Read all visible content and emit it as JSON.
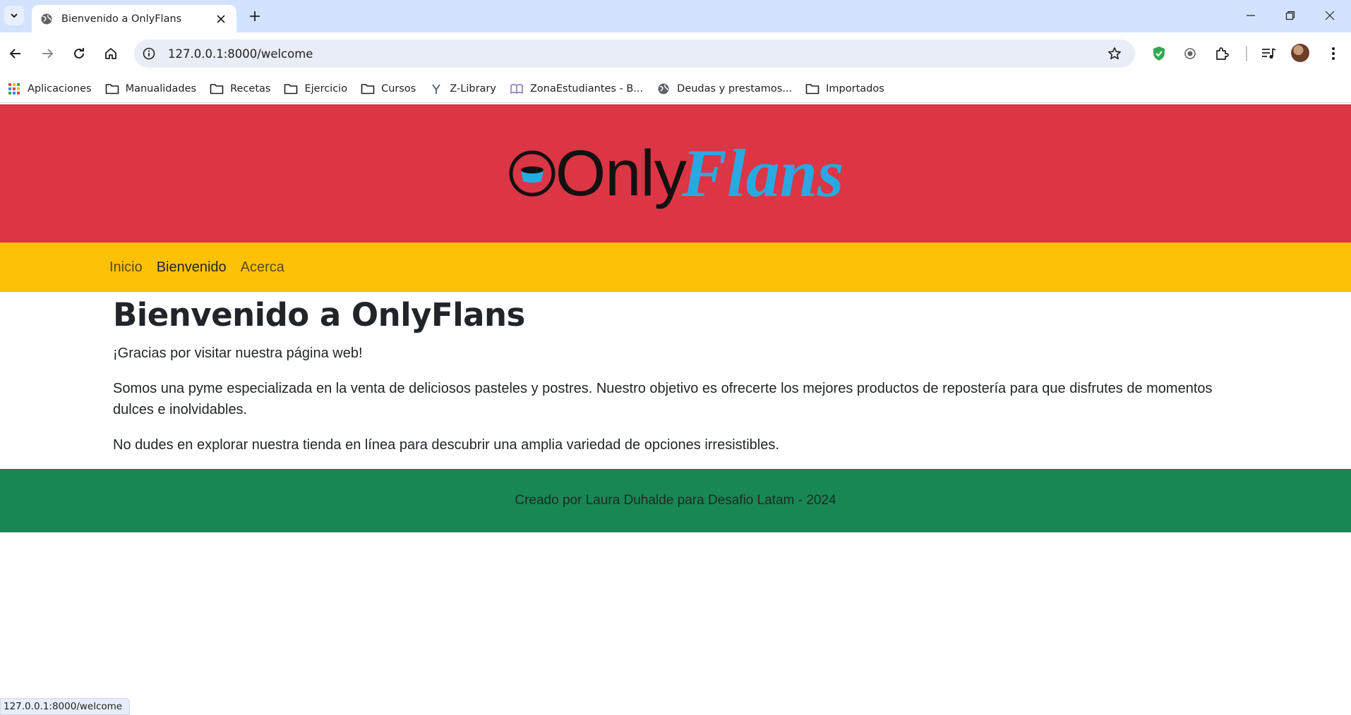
{
  "browser": {
    "tab": {
      "title": "Bienvenido a OnlyFlans",
      "favicon": "globe-icon"
    },
    "omnibox": {
      "url": "127.0.0.1:8000/welcome"
    },
    "bookmarks": [
      {
        "label": "Aplicaciones",
        "icon": "apps-grid-icon"
      },
      {
        "label": "Manualidades",
        "icon": "folder-icon"
      },
      {
        "label": "Recetas",
        "icon": "folder-icon"
      },
      {
        "label": "Ejercicio",
        "icon": "folder-icon"
      },
      {
        "label": "Cursos",
        "icon": "folder-icon"
      },
      {
        "label": "Z-Library",
        "icon": "zlibrary-icon"
      },
      {
        "label": "ZonaEstudiantes - B...",
        "icon": "book-icon"
      },
      {
        "label": "Deudas y prestamos...",
        "icon": "globe-icon"
      },
      {
        "label": "Importados",
        "icon": "folder-icon"
      }
    ],
    "status_url": "127.0.0.1:8000/welcome"
  },
  "site": {
    "logo": {
      "part1": "Only",
      "part2": "Flans"
    },
    "nav": [
      {
        "label": "Inicio",
        "active": false
      },
      {
        "label": "Bienvenido",
        "active": true
      },
      {
        "label": "Acerca",
        "active": false
      }
    ],
    "main": {
      "heading": "Bienvenido a OnlyFlans",
      "paragraphs": [
        "¡Gracias por visitar nuestra página web!",
        "Somos una pyme especializada en la venta de deliciosos pasteles y postres. Nuestro objetivo es ofrecerte los mejores productos de repostería para que disfrutes de momentos dulces e inolvidables.",
        "No dudes en explorar nuestra tienda en línea para descubrir una amplia variedad de opciones irresistibles."
      ]
    },
    "footer": "Creado por Laura Duhalde para Desafio Latam - 2024"
  },
  "colors": {
    "header_bg": "#dc3545",
    "nav_bg": "#ffc107",
    "footer_bg": "#198754",
    "logo_accent": "#29a9e1",
    "chrome_tabstrip": "#d3e3fd"
  }
}
